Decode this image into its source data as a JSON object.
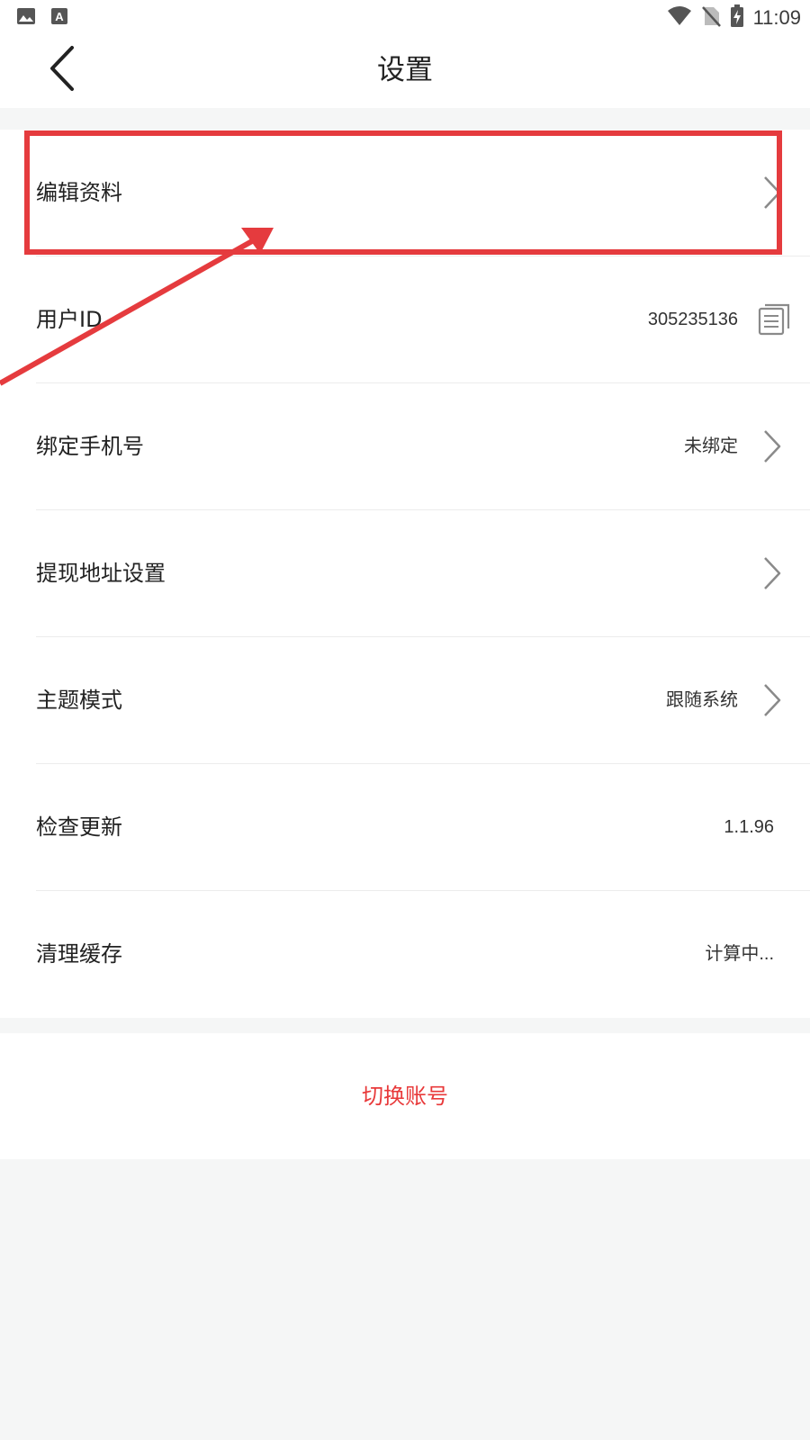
{
  "statusbar": {
    "time": "11:09",
    "icons_left": [
      "image-icon",
      "a-box-icon"
    ],
    "icons_right": [
      "wifi-icon",
      "no-sim-icon",
      "battery-charging-icon"
    ]
  },
  "header": {
    "title": "设置",
    "back_icon": "chevron-left-icon"
  },
  "settings": {
    "edit_profile": {
      "label": "编辑资料"
    },
    "user_id": {
      "label": "用户ID",
      "value": "305235136",
      "icon": "copy-icon"
    },
    "bind_phone": {
      "label": "绑定手机号",
      "value": "未绑定"
    },
    "withdraw_address": {
      "label": "提现地址设置"
    },
    "theme_mode": {
      "label": "主题模式",
      "value": "跟随系统"
    },
    "check_update": {
      "label": "检查更新",
      "value": "1.1.96"
    },
    "clear_cache": {
      "label": "清理缓存",
      "value": "计算中..."
    }
  },
  "switch_account": {
    "label": "切换账号"
  },
  "colors": {
    "accent_red": "#e8393a",
    "annotation_red": "#e53b3e",
    "background": "#f5f6f6",
    "card": "#ffffff"
  }
}
